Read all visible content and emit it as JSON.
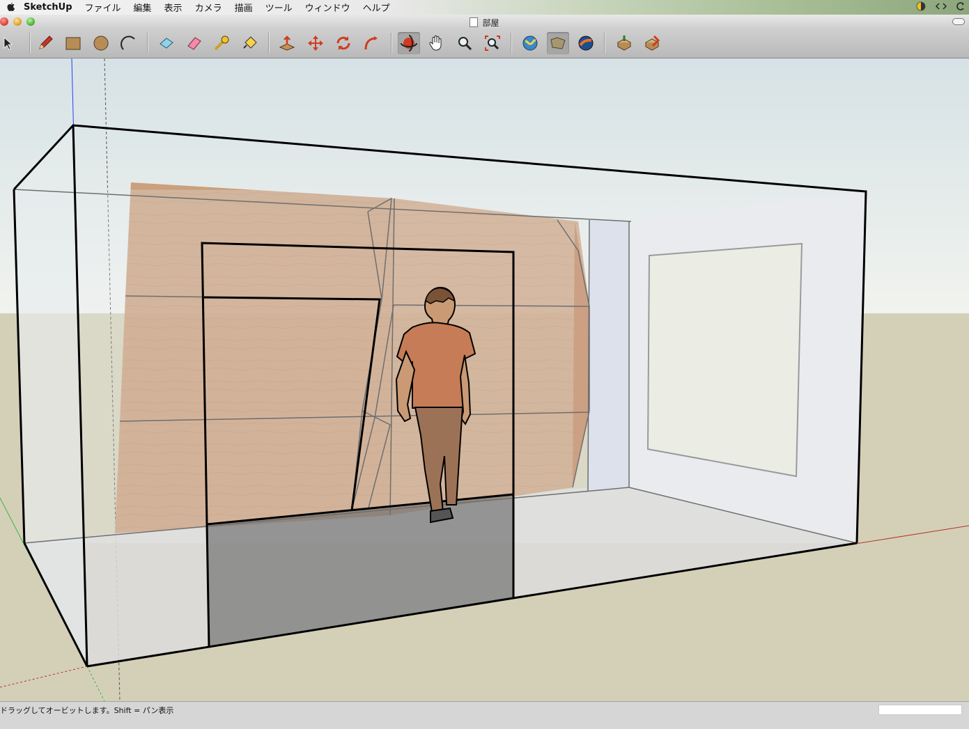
{
  "menubar": {
    "app_name": "SketchUp",
    "items": [
      "ファイル",
      "編集",
      "表示",
      "カメラ",
      "描画",
      "ツール",
      "ウィンドウ",
      "ヘルプ"
    ]
  },
  "window": {
    "title": "部屋"
  },
  "toolbar": {
    "tools": [
      {
        "name": "select-tool",
        "icon": "arrow-cursor-icon"
      },
      {
        "name": "line-tool",
        "icon": "pencil-icon"
      },
      {
        "name": "rectangle-tool",
        "icon": "rectangle-icon"
      },
      {
        "name": "circle-tool",
        "icon": "circle-icon"
      },
      {
        "name": "arc-tool",
        "icon": "arc-icon"
      },
      {
        "name": "make-component-tool",
        "icon": "component-icon"
      },
      {
        "name": "eraser-tool",
        "icon": "eraser-icon"
      },
      {
        "name": "tape-measure-tool",
        "icon": "tape-measure-icon"
      },
      {
        "name": "paint-bucket-tool",
        "icon": "paint-bucket-icon"
      },
      {
        "name": "push-pull-tool",
        "icon": "push-pull-icon"
      },
      {
        "name": "move-tool",
        "icon": "move-icon"
      },
      {
        "name": "rotate-tool",
        "icon": "rotate-icon"
      },
      {
        "name": "follow-me-tool",
        "icon": "follow-me-icon"
      },
      {
        "name": "orbit-tool",
        "icon": "orbit-icon"
      },
      {
        "name": "pan-tool",
        "icon": "hand-icon"
      },
      {
        "name": "zoom-tool",
        "icon": "magnifier-icon"
      },
      {
        "name": "zoom-extents-tool",
        "icon": "zoom-extents-icon"
      },
      {
        "name": "add-location-tool",
        "icon": "globe-icon"
      },
      {
        "name": "toggle-terrain-tool",
        "icon": "terrain-icon"
      },
      {
        "name": "get-models-tool",
        "icon": "warehouse-icon"
      },
      {
        "name": "share-model-tool",
        "icon": "share-model-icon"
      },
      {
        "name": "extension-warehouse-tool",
        "icon": "extension-icon"
      }
    ],
    "active_tool": "orbit-tool"
  },
  "status": {
    "text": "ドラッグしてオービットします。Shift = パン表示",
    "measurements_value": ""
  },
  "colors": {
    "sky": "#eaf0f1",
    "ground": "#d4d0b8",
    "wood": "#c99a74",
    "edge": "#000000",
    "accent_red": "#d23a1f"
  }
}
